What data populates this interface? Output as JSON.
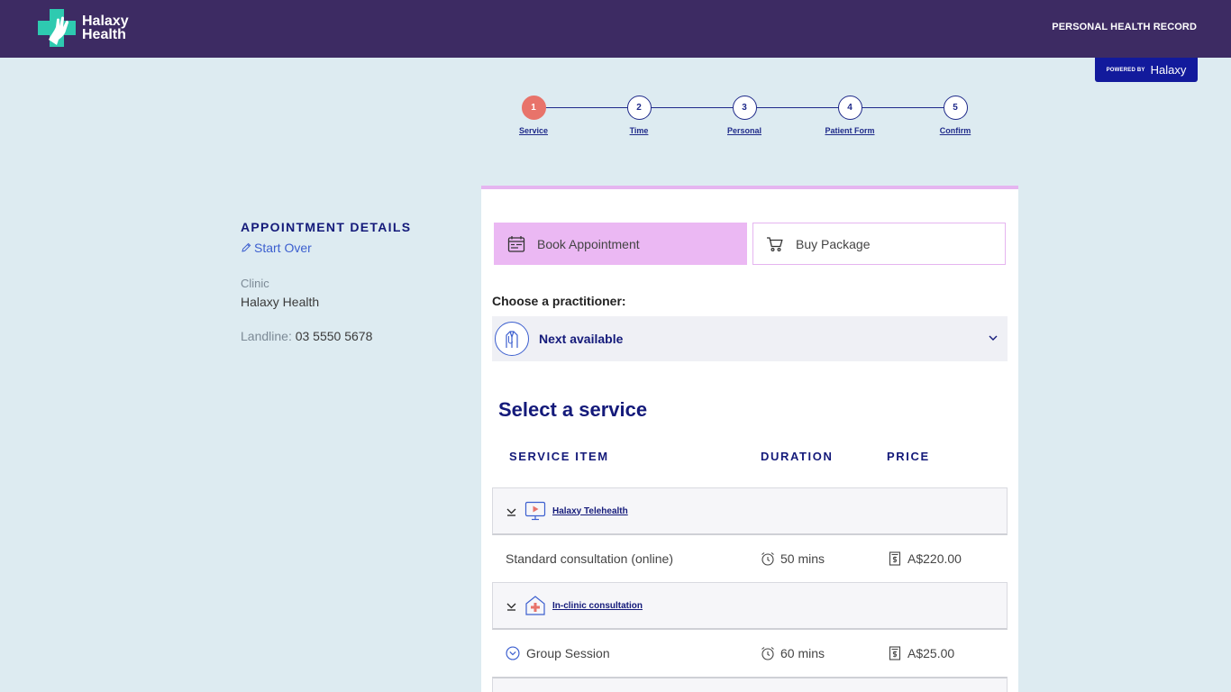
{
  "brand": {
    "name_line1": "Halaxy",
    "name_line2": "Health",
    "primary_color": "#3d2b63",
    "logo_color": "#2ecab0"
  },
  "header": {
    "phr_link": "PERSONAL HEALTH RECORD",
    "powered_by": "POWERED BY",
    "powered_name": "Halaxy"
  },
  "stepper": {
    "steps": [
      {
        "num": "1",
        "label": "Service",
        "active": true
      },
      {
        "num": "2",
        "label": "Time",
        "active": false
      },
      {
        "num": "3",
        "label": "Personal",
        "active": false
      },
      {
        "num": "4",
        "label": "Patient Form",
        "active": false
      },
      {
        "num": "5",
        "label": "Confirm",
        "active": false
      }
    ],
    "active_color": "#e8736a"
  },
  "details": {
    "title": "APPOINTMENT DETAILS",
    "start_over": "Start Over",
    "clinic_label": "Clinic",
    "clinic_value": "Halaxy Health",
    "landline_label": "Landline:",
    "landline_value": "03 5550 5678"
  },
  "tabs": {
    "book": "Book Appointment",
    "package": "Buy Package",
    "active_color": "#ebb8f3"
  },
  "practitioner": {
    "label": "Choose a practitioner:",
    "selected": "Next available"
  },
  "services": {
    "title": "Select a service",
    "headers": {
      "item": "SERVICE ITEM",
      "duration": "DURATION",
      "price": "PRICE"
    },
    "groups": [
      {
        "name": "Halaxy Telehealth",
        "icon": "telehealth-icon",
        "items": [
          {
            "name": "Standard consultation (online)",
            "duration": "50 mins",
            "price": "A$220.00"
          }
        ]
      },
      {
        "name": "In-clinic consultation",
        "icon": "clinic-icon",
        "items": [
          {
            "name": "Group Session",
            "duration": "60 mins",
            "price": "A$25.00"
          }
        ]
      }
    ]
  }
}
